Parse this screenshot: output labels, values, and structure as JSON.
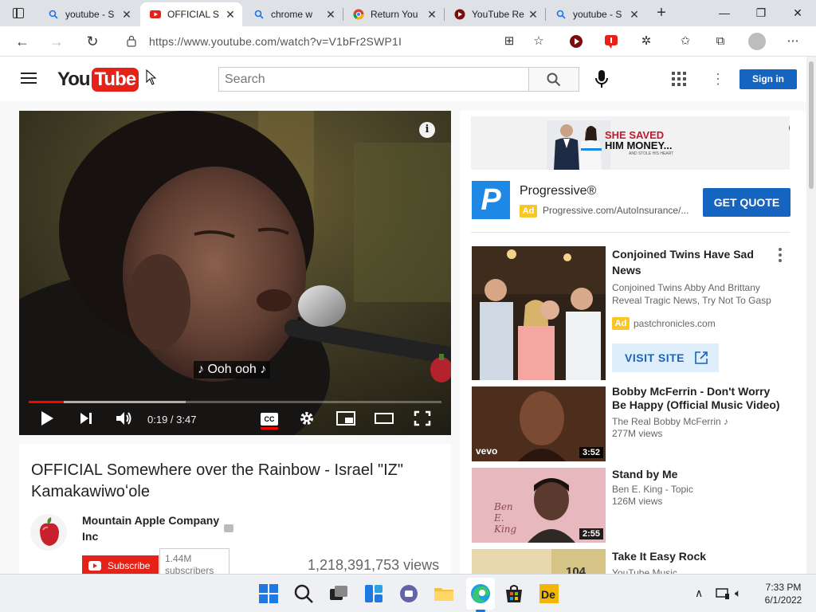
{
  "browser": {
    "tabs": [
      {
        "title": "youtube - S",
        "icon": "search-icon"
      },
      {
        "title": "OFFICIAL S",
        "icon": "youtube-icon"
      },
      {
        "title": "chrome w",
        "icon": "search-icon"
      },
      {
        "title": "Return You",
        "icon": "chrome-icon"
      },
      {
        "title": "YouTube Re",
        "icon": "extension-icon"
      },
      {
        "title": "youtube - S",
        "icon": "search-icon"
      }
    ],
    "url": "https://www.youtube.com/watch?v=V1bFr2SWP1I"
  },
  "youtube": {
    "logo_you": "You",
    "logo_tube": "Tube",
    "search_placeholder": "Search",
    "signin_label": "Sign in"
  },
  "player": {
    "caption": "♪ Ooh ooh ♪",
    "time_current": "0:19",
    "time_separator": " / ",
    "time_total": "3:47",
    "cc_label": "CC",
    "played_fraction": 0.084,
    "buffered_fraction": 0.38
  },
  "video": {
    "title": "OFFICIAL Somewhere over the Rainbow - Israel \"IZ\" Kamakawiwoʻole",
    "channel": "Mountain Apple Company Inc",
    "subscribe_label": "Subscribe",
    "subscriber_count": "1.44M subscribers",
    "views": "1,218,391,753 views"
  },
  "banner_ad": {
    "headline_1": "SHE SAVED",
    "headline_2": "HIM MONEY...",
    "subline": "AND STOLE HIS HEART"
  },
  "ad": {
    "logo_letter": "P",
    "advertiser": "Progressive®",
    "badge": "Ad",
    "url": "Progressive.com/AutoInsurance/...",
    "cta": "GET QUOTE"
  },
  "sidebar": {
    "promo": {
      "title": "Conjoined Twins Have Sad News",
      "description": "Conjoined Twins Abby And Brittany Reveal Tragic News, Try Not To Gasp",
      "badge": "Ad",
      "domain": "pastchronicles.com",
      "cta": "VISIT SITE"
    },
    "videos": [
      {
        "title": "Bobby McFerrin - Don't Worry Be Happy (Official Music Video)",
        "channel": "The Real Bobby McFerrin ♪",
        "views": "277M views",
        "duration": "3:52",
        "thumb_label": "vevo"
      },
      {
        "title": "Stand by Me",
        "channel": "Ben E. King - Topic",
        "views": "126M views",
        "duration": "2:55",
        "thumb_label": "Ben E. King"
      },
      {
        "title": "Take It Easy Rock",
        "channel": "YouTube Music",
        "views": "",
        "duration": "",
        "thumb_label": "104"
      }
    ]
  },
  "taskbar": {
    "time": "7:33 PM",
    "date": "6/1/2022"
  },
  "colors": {
    "youtube_red": "#e62117",
    "accent_blue": "#1565c0",
    "ad_yellow": "#f9c623"
  }
}
